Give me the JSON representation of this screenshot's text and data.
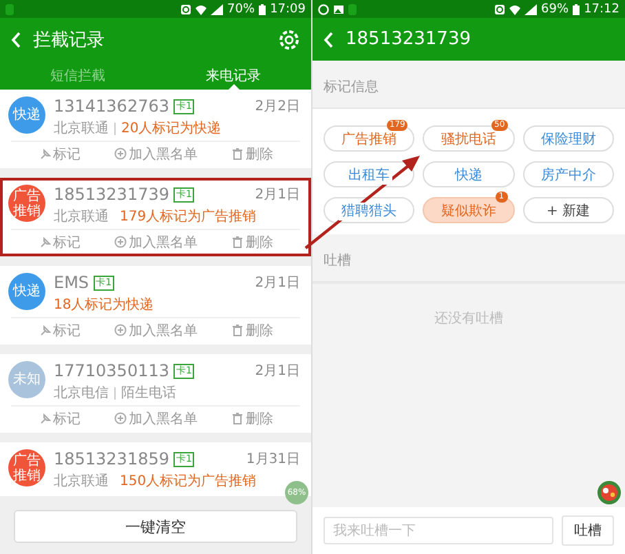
{
  "left_screen": {
    "status_bar": {
      "battery": "70%",
      "time": "17:09"
    },
    "header": {
      "title": "拦截记录"
    },
    "tabs": [
      {
        "label": "短信拦截",
        "selected": false
      },
      {
        "label": "来电记录",
        "selected": true
      }
    ],
    "calls": [
      {
        "avatar": "快递",
        "color": "#3d9be9",
        "number": "13141362763",
        "sim": "卡1",
        "carrier": "北京联通",
        "mark": "20人标记为快递",
        "date": "2月2日",
        "highlighted": false,
        "actions": [
          "标记",
          "加入黑名单",
          "删除"
        ]
      },
      {
        "avatar": "广告推销",
        "color": "#f0553a",
        "number": "18513231739",
        "sim": "卡1",
        "carrier": "北京联通",
        "mark": "179人标记为广告推销",
        "date": "2月1日",
        "highlighted": true,
        "actions": [
          "标记",
          "加入黑名单",
          "删除"
        ]
      },
      {
        "avatar": "快递",
        "color": "#3d9be9",
        "number": "EMS",
        "sim": "卡1",
        "mark": "18人标记为快递",
        "date": "2月1日",
        "highlighted": false,
        "actions": [
          "标记",
          "加入黑名单",
          "删除"
        ]
      },
      {
        "avatar": "未知",
        "color": "#a9c3dc",
        "number": "17710350113",
        "sim": "卡1",
        "carrier": "北京电信",
        "note": "陌生电话",
        "date": "2月1日",
        "highlighted": false,
        "actions": [
          "标记",
          "加入黑名单",
          "删除"
        ]
      },
      {
        "avatar": "广告推销",
        "color": "#f0553a",
        "number": "18513231859",
        "sim": "卡1",
        "carrier": "北京联通",
        "mark": "150人标记为广告推销",
        "date": "1月31日",
        "highlighted": false
      }
    ],
    "floating_badge": "68%",
    "clear_button": "一键清空"
  },
  "right_screen": {
    "status_bar": {
      "battery": "69%",
      "time": "17:12"
    },
    "header": {
      "title": "18513231739"
    },
    "tags_section": {
      "title": "标记信息",
      "tags": [
        {
          "label": "广告推销",
          "kind": "marked",
          "count": "179",
          "selected": false
        },
        {
          "label": "骚扰电话",
          "kind": "marked",
          "count": "50",
          "selected": false
        },
        {
          "label": "保险理财",
          "kind": "plain",
          "selected": false
        },
        {
          "label": "出租车",
          "kind": "plain",
          "selected": false
        },
        {
          "label": "快递",
          "kind": "plain",
          "selected": false
        },
        {
          "label": "房产中介",
          "kind": "plain",
          "selected": false
        },
        {
          "label": "猎聘猎头",
          "kind": "plain",
          "selected": false
        },
        {
          "label": "疑似欺诈",
          "kind": "marked",
          "count": "1",
          "selected": true
        },
        {
          "label": "+ 新建",
          "kind": "add",
          "selected": false
        }
      ]
    },
    "comments_section": {
      "title": "吐槽",
      "empty_text": "还没有吐槽"
    },
    "comment_input": {
      "placeholder": "我来吐槽一下"
    },
    "submit_button": "吐槽"
  }
}
